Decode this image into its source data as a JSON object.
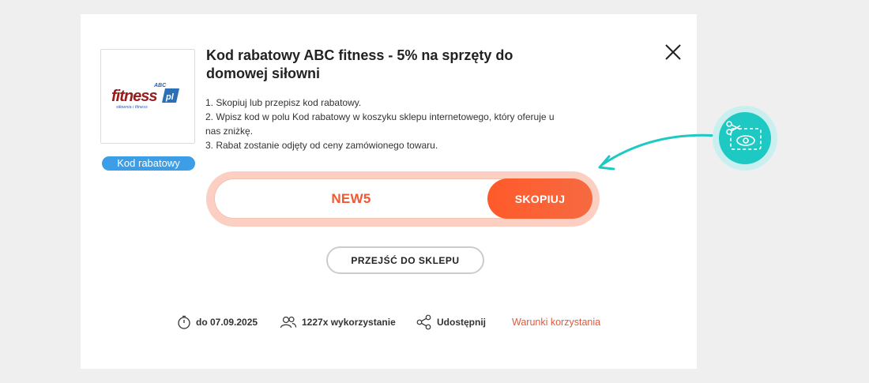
{
  "coupon": {
    "title": "Kod rabatowy ABC fitness - 5% na sprzęty do domowej siłowni",
    "badge": "Kod rabatowy",
    "instructions": [
      "1. Skopiuj lub przepisz kod rabatowy.",
      "2. Wpisz kod w polu Kod rabatowy w koszyku sklepu internetowego, który oferuje u nas zniżkę.",
      "3. Rabat zostanie odjęty od ceny zamówionego towaru."
    ],
    "code": "NEW5",
    "copy_label": "SKOPIUJ",
    "shop_label": "PRZEJŚĆ DO SKLEPU"
  },
  "logo": {
    "abc": "ABC",
    "fitness": "fitness",
    "pl": "pl",
    "tagline": "siłownia i fitness"
  },
  "footer": {
    "expiry": "do 07.09.2025",
    "usage": "1227x wykorzystanie",
    "share": "Udostępnij",
    "terms": "Warunki korzystania"
  },
  "colors": {
    "accent": "#f05a32",
    "badge": "#3d9ee8",
    "teal": "#1ec9c4"
  },
  "icons": [
    "close-icon",
    "timer-icon",
    "users-icon",
    "share-icon",
    "scissors-eye-icon",
    "arrow-icon"
  ]
}
